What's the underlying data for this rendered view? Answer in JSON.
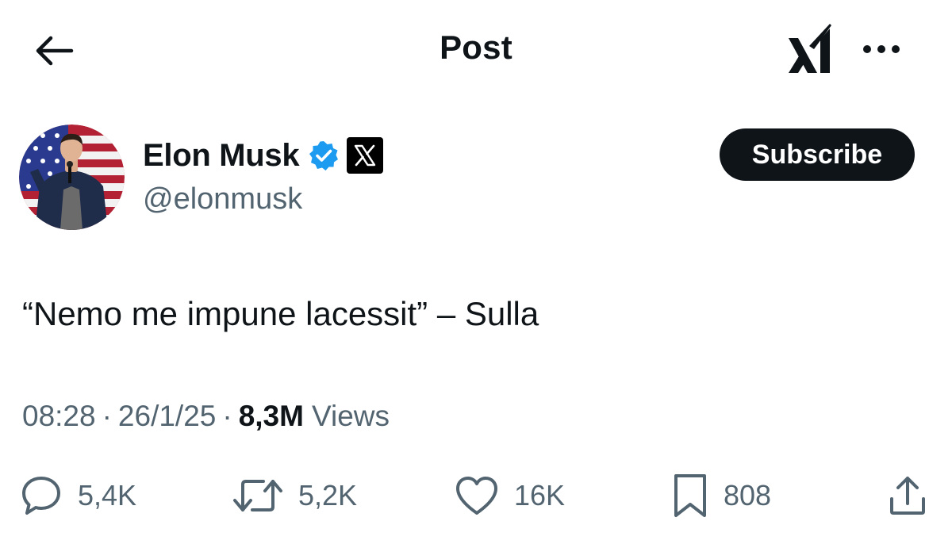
{
  "header": {
    "title": "Post",
    "back_icon": "arrow-left-icon",
    "grok_icon": "grok-logo-icon",
    "more_icon": "more-horizontal-icon"
  },
  "author": {
    "display_name": "Elon Musk",
    "handle": "@elonmusk",
    "verified": true,
    "verified_color": "#1d9bf0",
    "affiliate_icon": "x-logo-icon",
    "subscribe_label": "Subscribe"
  },
  "post": {
    "text": "“Nemo me impune lacessit” – Sulla",
    "time": "08:28",
    "date": "26/1/25",
    "views_count": "8,3M",
    "views_label": "Views"
  },
  "actions": {
    "replies": "5,4K",
    "reposts": "5,2K",
    "likes": "16K",
    "bookmarks": "808"
  },
  "colors": {
    "text_primary": "#0f1419",
    "text_secondary": "#536471",
    "button_bg": "#0f1419"
  }
}
